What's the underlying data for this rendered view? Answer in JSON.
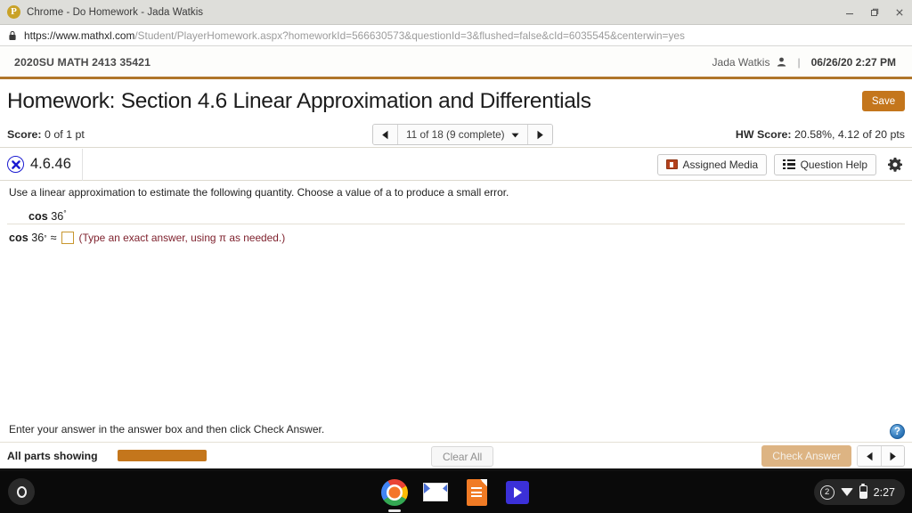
{
  "window": {
    "tab_favicon_letter": "P",
    "tab_title": "Chrome - Do Homework - Jada Watkis",
    "minimize_label": "minimize-icon",
    "maximize_label": "maximize-icon",
    "close_label": "close-icon"
  },
  "urlbar": {
    "lock_icon": "lock-icon",
    "url_domain": "https://www.mathxl.com",
    "url_path": "/Student/PlayerHomework.aspx?homeworkId=566630573&questionId=3&flushed=false&cId=6035545&centerwin=yes"
  },
  "course_header": {
    "course_name": "2020SU MATH 2413 35421",
    "user_name": "Jada Watkis",
    "person_icon": "person-icon",
    "divider": "|",
    "date_time": "06/26/20 2:27 PM",
    "accent_color": "#b0762a"
  },
  "title_row": {
    "page_title": "Homework: Section 4.6 Linear Approximation and Differentials",
    "save_label": "Save",
    "save_color": "#c4761c"
  },
  "score_bar": {
    "score_label": "Score:",
    "score_value": "0 of 1 pt",
    "pager": {
      "prev_icon": "triangle-left-icon",
      "label": "11 of 18 (9 complete)",
      "dropdown_icon": "chevron-down-icon",
      "next_icon": "triangle-right-icon"
    },
    "hw_score_label": "HW Score:",
    "hw_score_value": "20.58%, 4.12 of 20 pts"
  },
  "question_bar": {
    "status_icon": "incorrect-x-icon",
    "question_id": "4.6.46",
    "assigned_media_label": "Assigned Media",
    "assigned_media_icon": "media-projector-icon",
    "question_help_label": "Question Help",
    "question_help_icon": "list-icon",
    "settings_icon": "gear-icon"
  },
  "question": {
    "prompt": "Use a linear approximation to estimate the following quantity. Choose a value of a to produce a small error.",
    "expression_fn": "cos",
    "expression_arg": "36",
    "expression_degree": "°",
    "answer_fn": "cos",
    "answer_arg": "36",
    "answer_degree": "°",
    "approx_symbol": "≈",
    "answer_value": "",
    "answer_placeholder": "",
    "hint": "(Type an exact answer, using π as needed.)",
    "hint_color": "#7d1f2b",
    "input_border_color": "#c8962e"
  },
  "footer": {
    "instruction": "Enter your answer in the answer box and then click Check Answer.",
    "help_icon": "question-mark-help-icon",
    "help_glyph": "?"
  },
  "action_bar": {
    "parts_label": "All parts showing",
    "progress_color": "#c4761c",
    "progress_percent": 100,
    "clear_all_label": "Clear All",
    "check_answer_label": "Check Answer",
    "check_answer_color": "#ddb483",
    "prev_icon": "triangle-left-icon",
    "next_icon": "triangle-right-icon"
  },
  "shelf": {
    "launcher_icon": "launcher-circle-icon",
    "apps": [
      {
        "name": "chrome-app-icon",
        "label": "Chrome",
        "active": true
      },
      {
        "name": "gmail-app-icon",
        "label": "Gmail",
        "active": false
      },
      {
        "name": "docs-app-icon",
        "label": "Docs",
        "active": false
      },
      {
        "name": "play-app-icon",
        "label": "Play",
        "active": false
      }
    ],
    "tray": {
      "badge_count": "2",
      "wifi_icon": "wifi-icon",
      "battery_icon": "battery-icon",
      "clock": "2:27"
    }
  }
}
